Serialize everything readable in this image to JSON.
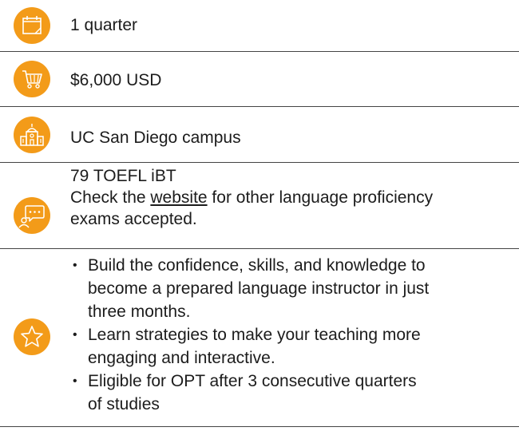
{
  "rows": {
    "duration": {
      "text": "1 quarter",
      "icon": "calendar-icon"
    },
    "cost": {
      "text": "$6,000 USD",
      "icon": "shopping-cart-icon"
    },
    "location": {
      "text": "UC San Diego campus",
      "icon": "campus-building-icon"
    },
    "language": {
      "line1": "79 TOEFL iBT",
      "check_prefix": "Check the ",
      "link_text": "website",
      "check_suffix": " for other language proficiency",
      "line3": "exams accepted.",
      "icon": "chat-person-icon"
    },
    "highlights": {
      "icon": "star-icon",
      "items": [
        {
          "l1": "Build the confidence, skills, and knowledge to",
          "l2": "become a prepared language instructor in just",
          "l3": "three months."
        },
        {
          "l1": "Learn strategies to make your teaching more",
          "l2": "engaging and interactive."
        },
        {
          "l1": "Eligible for OPT after 3 consecutive quarters",
          "l2": "of studies"
        }
      ]
    }
  },
  "colors": {
    "accent": "#f39b19",
    "divider": "#444444",
    "text": "#1c1c1c"
  }
}
